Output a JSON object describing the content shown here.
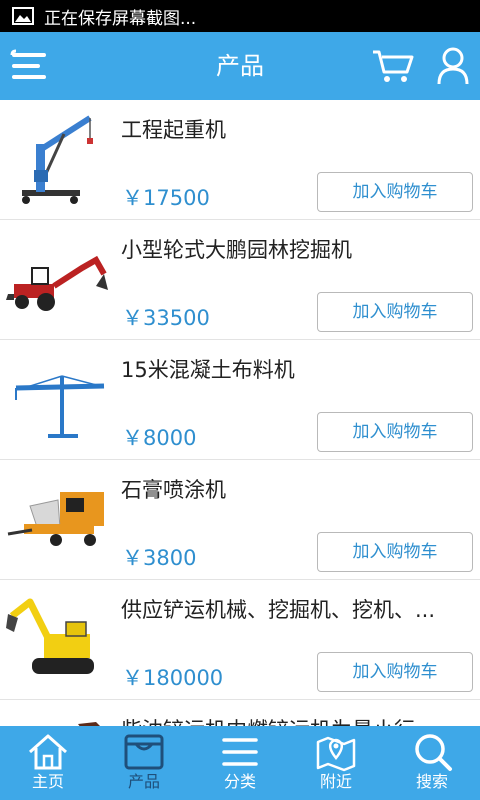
{
  "status_bar": {
    "text": "正在保存屏幕截图..."
  },
  "header": {
    "title": "产品"
  },
  "products": [
    {
      "name": "工程起重机",
      "price": "￥17500",
      "button": "加入购物车"
    },
    {
      "name": "小型轮式大鹏园林挖掘机",
      "price": "￥33500",
      "button": "加入购物车"
    },
    {
      "name": "15米混凝土布料机",
      "price": "￥8000",
      "button": "加入购物车"
    },
    {
      "name": "石膏喷涂机",
      "price": "￥3800",
      "button": "加入购物车"
    },
    {
      "name": "供应铲运机械、挖掘机、挖机、...",
      "price": "￥180000",
      "button": "加入购物车"
    },
    {
      "name": "柴油铲运机内燃铲运机为最小行",
      "price": "",
      "button": ""
    }
  ],
  "tabs": [
    {
      "label": "主页",
      "icon": "home-icon"
    },
    {
      "label": "产品",
      "icon": "product-box-icon",
      "active": true
    },
    {
      "label": "分类",
      "icon": "list-icon"
    },
    {
      "label": "附近",
      "icon": "map-icon"
    },
    {
      "label": "搜索",
      "icon": "search-icon"
    }
  ],
  "colors": {
    "accent": "#3ea8e8",
    "price": "#2f8fcf",
    "active_tab_text": "#1f4f7a"
  }
}
